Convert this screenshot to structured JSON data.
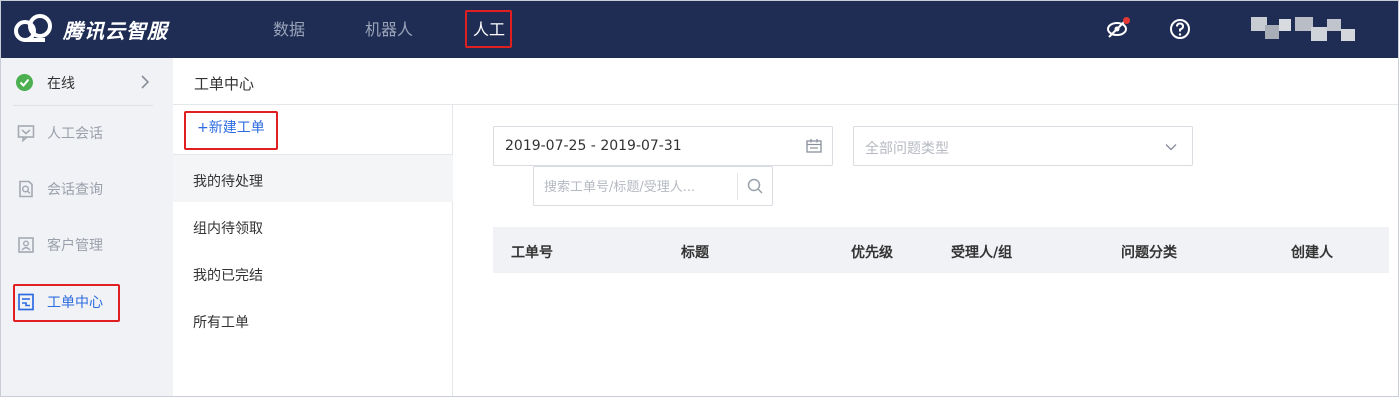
{
  "brand": {
    "name": "腾讯云智服"
  },
  "nav": {
    "items": [
      {
        "label": "数据",
        "active": false
      },
      {
        "label": "机器人",
        "active": false
      },
      {
        "label": "人工",
        "active": true
      }
    ]
  },
  "topbar_icons": [
    "visibility-off-icon",
    "help-icon"
  ],
  "sidebar": {
    "status": {
      "label": "在线"
    },
    "items": [
      {
        "label": "人工会话",
        "icon": "chat-icon",
        "active": false
      },
      {
        "label": "会话查询",
        "icon": "search-doc-icon",
        "active": false
      },
      {
        "label": "客户管理",
        "icon": "contact-card-icon",
        "active": false
      },
      {
        "label": "工单中心",
        "icon": "ticket-icon",
        "active": true
      }
    ]
  },
  "page": {
    "title": "工单中心"
  },
  "ticket_list": {
    "new_button": "新建工单",
    "items": [
      {
        "label": "我的待处理",
        "selected": true
      },
      {
        "label": "组内待领取",
        "selected": false
      },
      {
        "label": "我的已完结",
        "selected": false
      },
      {
        "label": "所有工单",
        "selected": false
      }
    ]
  },
  "filters": {
    "date_range": "2019-07-25 - 2019-07-31",
    "type_placeholder": "全部问题类型",
    "search_placeholder": "搜索工单号/标题/受理人..."
  },
  "table": {
    "columns": [
      "工单号",
      "标题",
      "优先级",
      "受理人/组",
      "问题分类",
      "创建人"
    ],
    "rows": []
  },
  "colors": {
    "topbar": "#1f2d55",
    "accent": "#2d6ce0",
    "highlight": "#e02020",
    "online": "#4caf50"
  }
}
